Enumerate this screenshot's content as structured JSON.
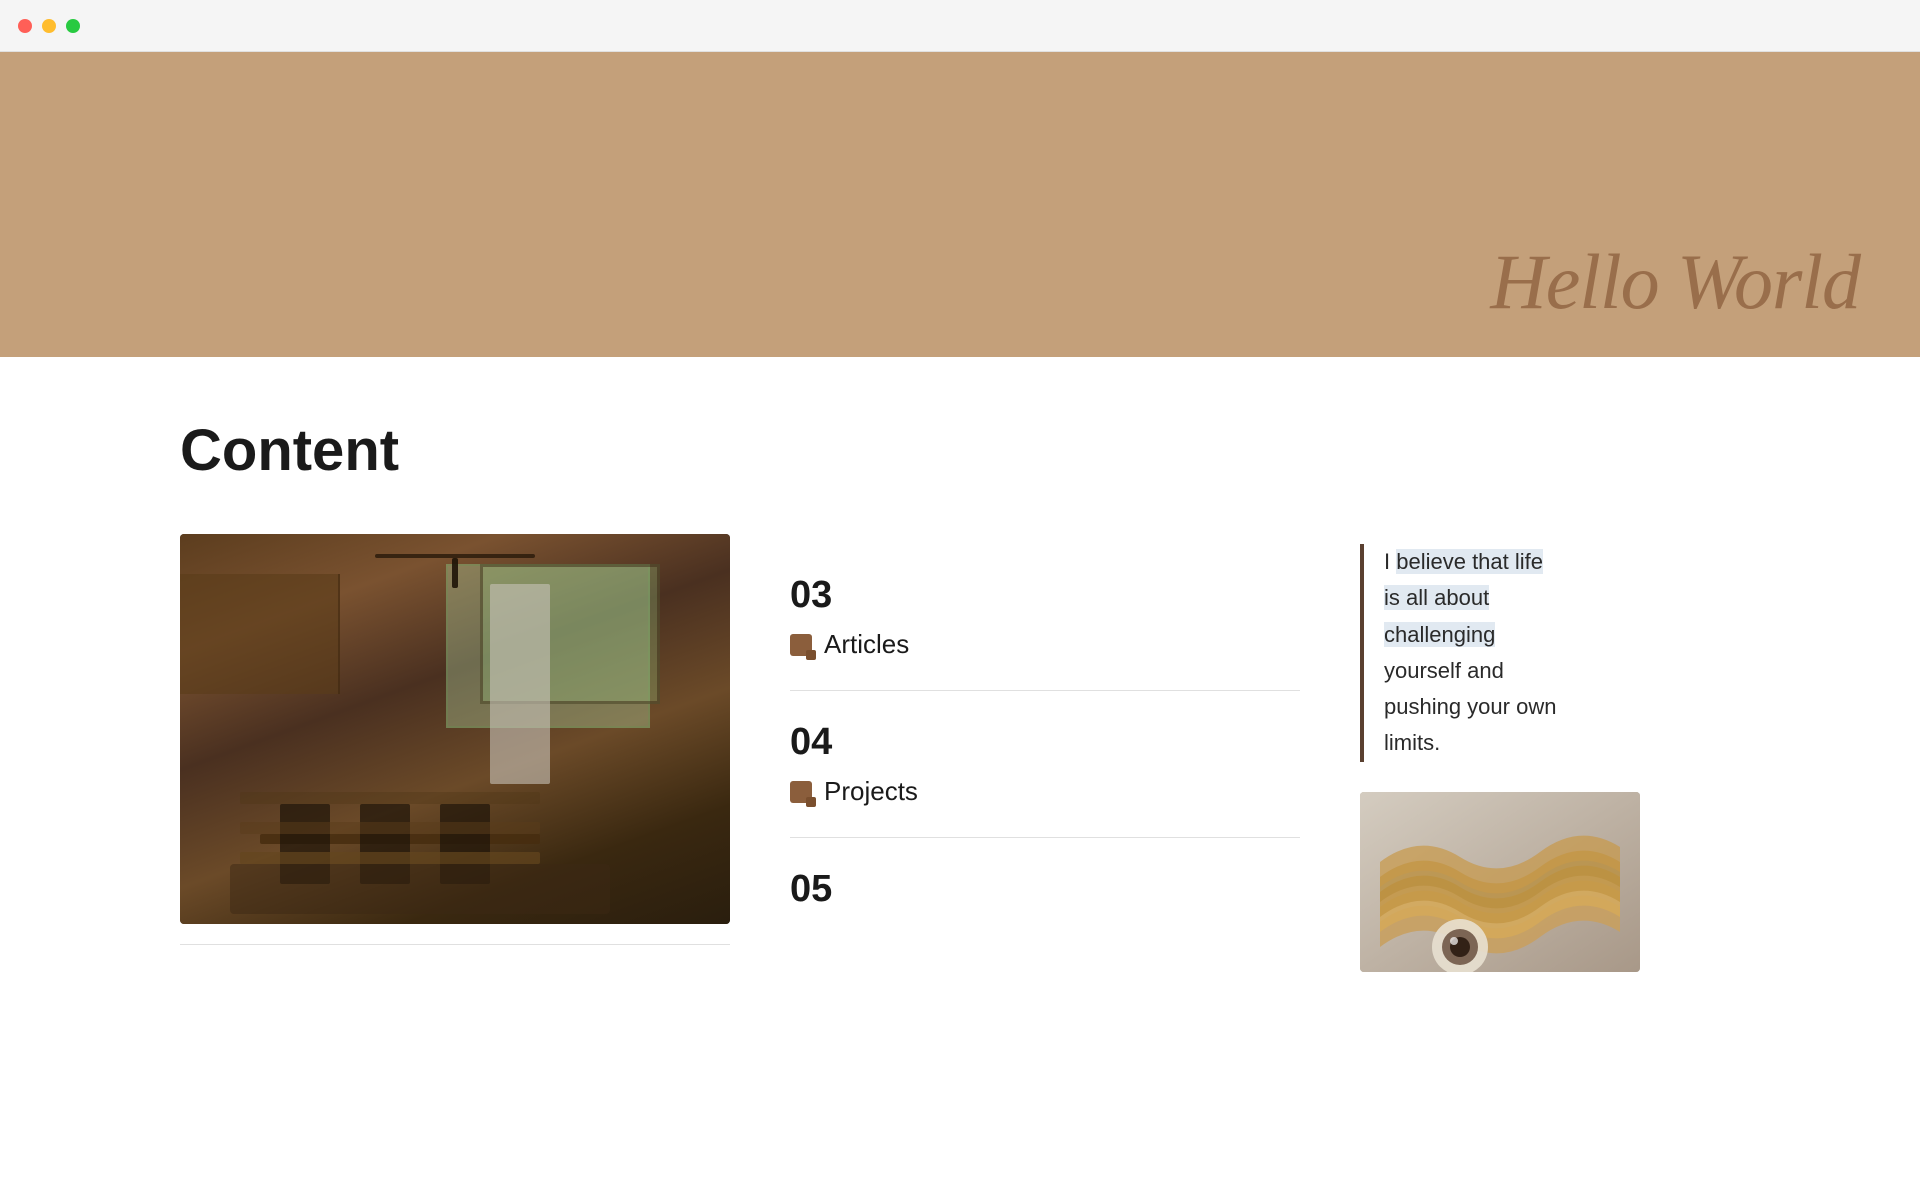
{
  "titlebar": {
    "dots": [
      "red",
      "yellow",
      "green"
    ]
  },
  "hero": {
    "title": "Hello World",
    "background_color": "#c4a07a"
  },
  "main": {
    "section_title": "Content",
    "items": [
      {
        "number": "03",
        "label": "Articles",
        "has_divider": true
      },
      {
        "number": "04",
        "label": "Projects",
        "has_divider": true
      },
      {
        "number": "05",
        "label": "",
        "has_divider": false
      }
    ],
    "quote": {
      "lines": [
        "I believe that life",
        "is all about",
        "challenging",
        "yourself and",
        "pushing your own",
        "limits."
      ],
      "full_text": "I believe that life is all about challenging yourself and pushing your own limits.",
      "highlighted_words": [
        "that life",
        "is all about",
        "challenging"
      ]
    }
  }
}
